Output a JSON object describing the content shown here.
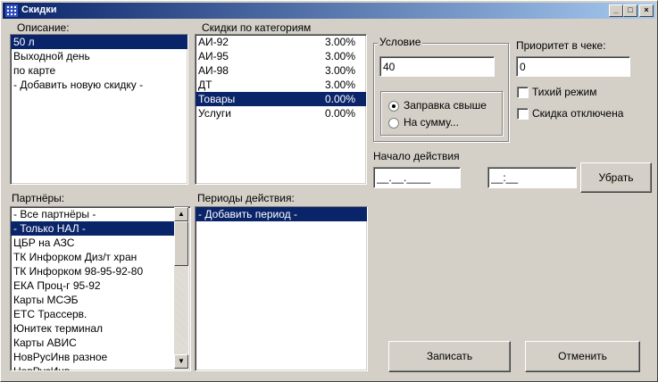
{
  "window": {
    "title": "Скидки",
    "btn_min": "_",
    "btn_max": "□",
    "btn_close": "×"
  },
  "labels": {
    "description": "Описание:",
    "category_discounts": "Скидки по категориям",
    "partners": "Партнёры:",
    "periods": "Периоды действия:",
    "condition": "Условие",
    "priority": "Приоритет в чеке:",
    "quiet_mode": "Тихий режим",
    "discount_off": "Скидка отключена",
    "start": "Начало действия"
  },
  "description_items": [
    {
      "label": "50 л",
      "selected": true
    },
    {
      "label": "Выходной день",
      "selected": false
    },
    {
      "label": "по карте",
      "selected": false
    },
    {
      "label": " - Добавить новую скидку -",
      "selected": false
    }
  ],
  "category_items": [
    {
      "label": "АИ-92",
      "value": "3.00%",
      "selected": false
    },
    {
      "label": "АИ-95",
      "value": "3.00%",
      "selected": false
    },
    {
      "label": "АИ-98",
      "value": "3.00%",
      "selected": false
    },
    {
      "label": "ДТ",
      "value": "3.00%",
      "selected": false
    },
    {
      "label": "Товары",
      "value": "0.00%",
      "selected": true
    },
    {
      "label": "Услуги",
      "value": "0.00%",
      "selected": false
    }
  ],
  "partner_items": [
    {
      "label": " - Все партнёры -",
      "selected": false
    },
    {
      "label": " - Только НАЛ -",
      "selected": true
    },
    {
      "label": "ЦБР на АЗС",
      "selected": false
    },
    {
      "label": "ТК Инфорком Диз/т хран",
      "selected": false
    },
    {
      "label": "ТК Инфорком 98-95-92-80",
      "selected": false
    },
    {
      "label": "ЕКА Проц-г 95-92",
      "selected": false
    },
    {
      "label": "Карты МСЭБ",
      "selected": false
    },
    {
      "label": "ЕТС Трассерв.",
      "selected": false
    },
    {
      "label": "Юнитек терминал",
      "selected": false
    },
    {
      "label": "Карты АВИС",
      "selected": false
    },
    {
      "label": "НовРусИнв разное",
      "selected": false
    },
    {
      "label": "НовРусИнв",
      "selected": false
    }
  ],
  "period_items": [
    {
      "label": " - Добавить период -",
      "selected": true
    }
  ],
  "condition": {
    "value": "40",
    "radio_refuel": "Заправка свыше",
    "radio_sum": "На сумму...",
    "selected": "refuel"
  },
  "priority": {
    "value": "0"
  },
  "quiet_mode": {
    "checked": false
  },
  "discount_off": {
    "checked": false
  },
  "start": {
    "date_mask": "__.__.____",
    "time_mask": "__:__"
  },
  "buttons": {
    "remove": "Убрать",
    "save": "Записать",
    "cancel": "Отменить"
  }
}
